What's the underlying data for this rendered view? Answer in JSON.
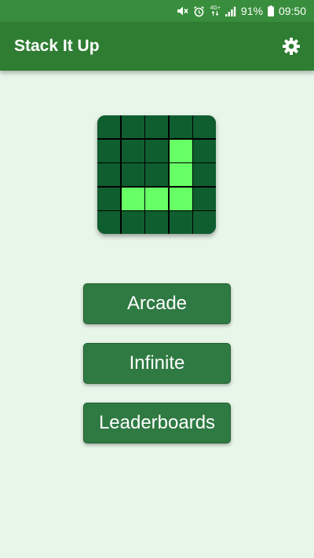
{
  "status_bar": {
    "network": "4G+",
    "battery": "91%",
    "time": "09:50",
    "icons": [
      "mute-icon",
      "alarm-icon",
      "signal-icon",
      "battery-icon"
    ]
  },
  "app_bar": {
    "title": "Stack It Up",
    "settings_icon": "gear-icon"
  },
  "logo": {
    "grid_size": 5,
    "filled": [
      [
        1,
        3
      ],
      [
        2,
        3
      ],
      [
        3,
        1
      ],
      [
        3,
        2
      ],
      [
        3,
        3
      ]
    ]
  },
  "menu": {
    "buttons": [
      {
        "label": "Arcade"
      },
      {
        "label": "Infinite"
      },
      {
        "label": "Leaderboards"
      }
    ]
  },
  "colors": {
    "status_bar": "#388e3c",
    "app_bar": "#2e7d32",
    "background": "#e8f5e9",
    "button": "#2f7a43",
    "cell_dark": "#0f5e30",
    "cell_lit": "#66ff66"
  }
}
